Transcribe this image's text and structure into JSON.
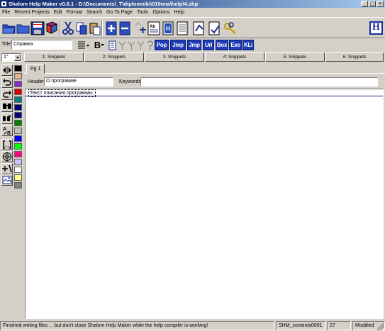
{
  "window": {
    "title": "Shalom Help Maker v0.6.1 - D:\\Documents\\_T\\diplomniki\\01\\Inna\\help\\4.shp",
    "minimize": "_",
    "maximize": "□",
    "close": "×"
  },
  "menu": [
    "File",
    "Recent Projects",
    "Edit",
    "Format",
    "Search",
    "Go To Page",
    "Tools",
    "Options",
    "Help"
  ],
  "toolbar1": {
    "icons": [
      "open-folder-icon",
      "folder-icon",
      "save-icon",
      "books-icon",
      "cut-icon",
      "copy-icon",
      "paste-icon",
      "new-page-icon",
      "delete-page-icon",
      "move-up-icon",
      "move-down-icon",
      "contents-icon",
      "compile-icon",
      "report-icon",
      "document-icon",
      "compile-run-icon",
      "keys-icon"
    ],
    "help_label": "H"
  },
  "toolbar2": {
    "title_label": "Title:",
    "title_value": "Справка",
    "bold_label": "B",
    "keyword_buttons": [
      "Pop",
      "Jmp",
      "Jmp",
      "Url",
      "Box",
      "Exe",
      "KLi"
    ]
  },
  "snippets": {
    "combo_value": "1°",
    "buttons": [
      "1: Snippets",
      "2: Snippets",
      "3: Snippets",
      "4: Snippets",
      "5: Snippets",
      "6: Snippets"
    ]
  },
  "left_tools": [
    "resize-horizontal-icon",
    "undo-icon",
    "redo-icon",
    "find-icon",
    "replace-icon",
    "spell-icon",
    "brackets-icon",
    "target-icon",
    "add-link-icon",
    "image-icon"
  ],
  "palette": [
    "#000000",
    "#e8b090",
    "#8b2fc8",
    "#e00000",
    "#008080",
    "#000080",
    "#00007f",
    "#008000",
    "#c0c0c0",
    "#0000ff",
    "#00ff00",
    "#ff0080",
    "#c8c8ff",
    "#ffffff",
    "#ffff80",
    "#808080"
  ],
  "page": {
    "tab": "Pg 1",
    "header_label": "Header:",
    "header_value": "О программе",
    "keywords_label": "Keywords:",
    "keywords_value": "",
    "body_text": "Текст описания программы."
  },
  "status": {
    "message": "Finished writing files ... but don't close Shalom Help Maker while the help compiler is working!",
    "contents": "SHM_contents0001",
    "number": "27",
    "state": "Modified"
  }
}
